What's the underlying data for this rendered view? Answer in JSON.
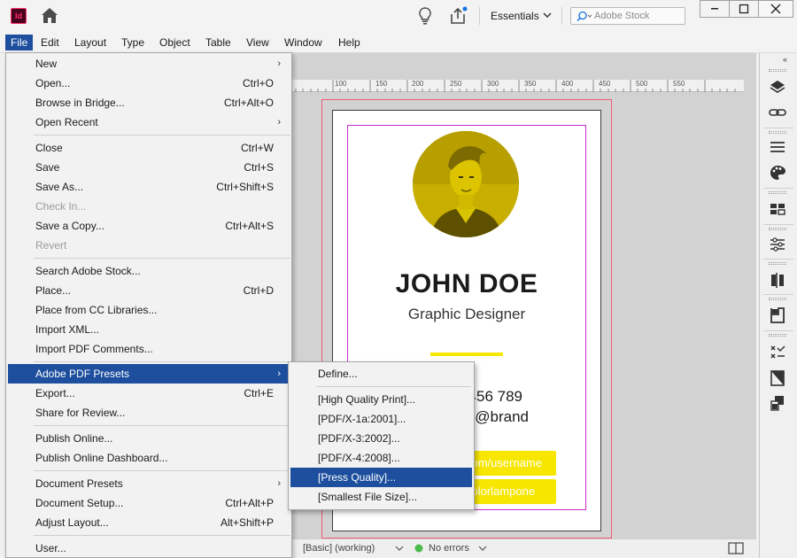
{
  "app": {
    "icon_text": "Id",
    "workspace": "Essentials",
    "search_placeholder": "Adobe Stock"
  },
  "menubar": [
    "File",
    "Edit",
    "Layout",
    "Type",
    "Object",
    "Table",
    "View",
    "Window",
    "Help"
  ],
  "file_menu": {
    "groups": [
      [
        {
          "label": "New",
          "shortcut": "",
          "submenu": true
        },
        {
          "label": "Open...",
          "shortcut": "Ctrl+O"
        },
        {
          "label": "Browse in Bridge...",
          "shortcut": "Ctrl+Alt+O"
        },
        {
          "label": "Open Recent",
          "shortcut": "",
          "submenu": true
        }
      ],
      [
        {
          "label": "Close",
          "shortcut": "Ctrl+W"
        },
        {
          "label": "Save",
          "shortcut": "Ctrl+S"
        },
        {
          "label": "Save As...",
          "shortcut": "Ctrl+Shift+S"
        },
        {
          "label": "Check In...",
          "shortcut": "",
          "disabled": true
        },
        {
          "label": "Save a Copy...",
          "shortcut": "Ctrl+Alt+S"
        },
        {
          "label": "Revert",
          "shortcut": "",
          "disabled": true
        }
      ],
      [
        {
          "label": "Search Adobe Stock...",
          "shortcut": ""
        },
        {
          "label": "Place...",
          "shortcut": "Ctrl+D"
        },
        {
          "label": "Place from CC Libraries...",
          "shortcut": ""
        },
        {
          "label": "Import XML...",
          "shortcut": ""
        },
        {
          "label": "Import PDF Comments...",
          "shortcut": ""
        }
      ],
      [
        {
          "label": "Adobe PDF Presets",
          "shortcut": "",
          "submenu": true,
          "highlighted": true
        },
        {
          "label": "Export...",
          "shortcut": "Ctrl+E"
        },
        {
          "label": "Share for Review...",
          "shortcut": ""
        }
      ],
      [
        {
          "label": "Publish Online...",
          "shortcut": ""
        },
        {
          "label": "Publish Online Dashboard...",
          "shortcut": ""
        }
      ],
      [
        {
          "label": "Document Presets",
          "shortcut": "",
          "submenu": true
        },
        {
          "label": "Document Setup...",
          "shortcut": "Ctrl+Alt+P"
        },
        {
          "label": "Adjust Layout...",
          "shortcut": "Alt+Shift+P"
        }
      ],
      [
        {
          "label": "User...",
          "shortcut": ""
        }
      ]
    ]
  },
  "pdf_presets_submenu": {
    "define": "Define...",
    "presets": [
      {
        "label": "[High Quality Print]..."
      },
      {
        "label": "[PDF/X-1a:2001]..."
      },
      {
        "label": "[PDF/X-3:2002]..."
      },
      {
        "label": "[PDF/X-4:2008]..."
      },
      {
        "label": "[Press Quality]...",
        "highlighted": true
      },
      {
        "label": "[Smallest File Size]..."
      }
    ]
  },
  "ruler": {
    "labels": [
      "100",
      "150",
      "200",
      "250",
      "300",
      "350",
      "400",
      "450",
      "500",
      "550"
    ]
  },
  "document": {
    "name": "JOHN DOE",
    "role": "Graphic Designer",
    "phone": "456 789",
    "handle": "@brand",
    "pill1": "com/username",
    "pill2": "colorlampone"
  },
  "statusbar": {
    "preflight_profile": "[Basic] (working)",
    "errors": "No errors"
  },
  "colors": {
    "menu_highlight": "#1d4f9e",
    "accent_yellow": "#f6e600",
    "margin_guide": "#c72ecb",
    "bleed_guide": "#ef5a6f",
    "no_errors_dot": "#4cbb4c"
  }
}
